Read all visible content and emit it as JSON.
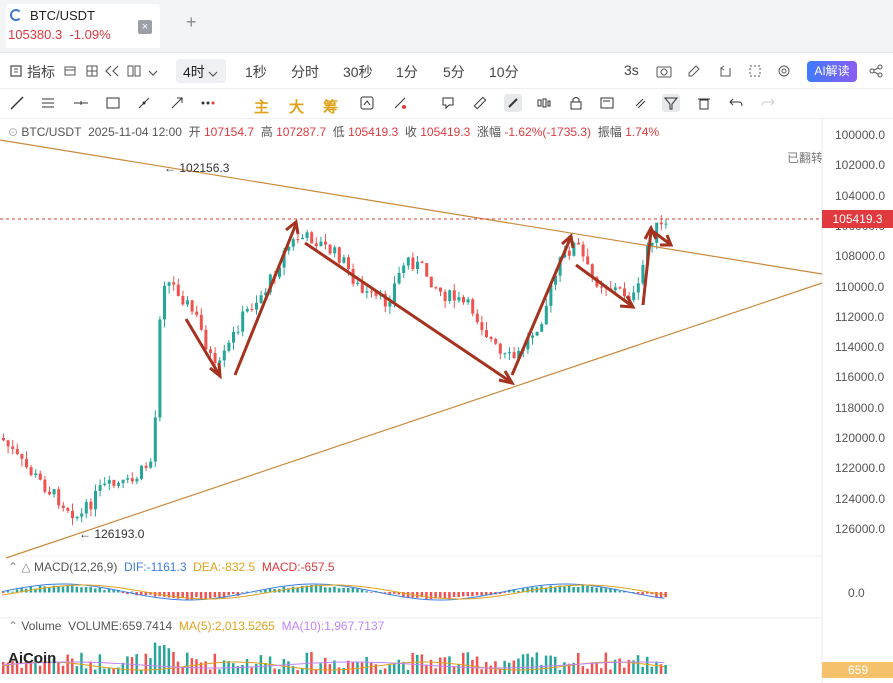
{
  "tab": {
    "title": "BTC/USDT",
    "price": "105380.3",
    "change": "-1.09%",
    "close": "×",
    "add": "+"
  },
  "toolbar": {
    "indicator": "指标",
    "intervals": [
      "4时",
      "1秒",
      "分时",
      "30秒",
      "1分",
      "5分",
      "10分"
    ],
    "countdown": "3s",
    "ai": "AI解读"
  },
  "draw_tools": {
    "main": "主",
    "big": "大",
    "chip": "筹"
  },
  "info": {
    "pair": "BTC/USDT",
    "date": "2025-11-04 12:00",
    "open_label": "开",
    "open": "107154.7",
    "high_label": "高",
    "high": "107287.7",
    "low_label": "低",
    "low": "105419.3",
    "close_label": "收",
    "close": "105419.3",
    "chg_label": "涨幅",
    "chg": "-1.62%(-1735.3)",
    "amp_label": "振幅",
    "amp": "1.74%"
  },
  "flip_label": "已翻转",
  "price_axis": [
    "100000.0",
    "102000.0",
    "104000.0",
    "106000.0",
    "108000.0",
    "110000.0",
    "112000.0",
    "114000.0",
    "116000.0",
    "118000.0",
    "120000.0",
    "122000.0",
    "124000.0",
    "126000.0"
  ],
  "current_price": "105419.3",
  "annotations": {
    "peak": "102156.3",
    "trough": "126193.0"
  },
  "macd": {
    "label": "MACD(12,26,9)",
    "dif": "DIF:-1161.3",
    "dea": "DEA:-832.5",
    "macd": "MACD:-657.5",
    "axis": "0.0"
  },
  "volume": {
    "label": "Volume",
    "value": "VOLUME:659.7414",
    "ma5": "MA(5):2,013.5265",
    "ma10": "MA(10):1,967.7137",
    "tag": "659"
  },
  "logo": "AiCoin",
  "colors": {
    "up": "#26a69a",
    "down": "#ef5350",
    "arrow": "#a5321f",
    "trend": "#c98a3c",
    "accent": "#e0393e"
  }
}
